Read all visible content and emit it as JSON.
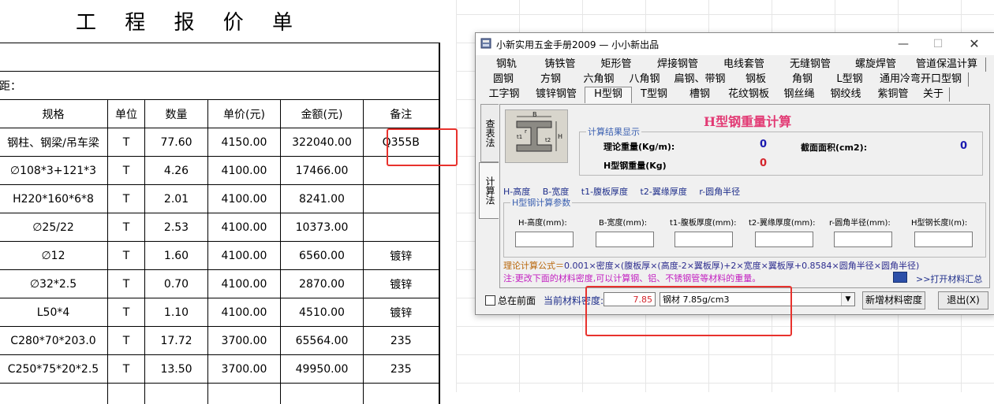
{
  "sheet": {
    "title": "工 程 报 价 单",
    "distance_label": "距：",
    "headers": [
      "规格",
      "单位",
      "数量",
      "单价(元)",
      "金额(元)",
      "备注"
    ],
    "rows": [
      {
        "spec": "钢柱、钢梁/吊车梁",
        "unit": "T",
        "qty": "77.60",
        "price": "4150.00",
        "amount": "322040.00",
        "note": "Q355B"
      },
      {
        "spec": "∅108*3+121*3",
        "unit": "T",
        "qty": "4.26",
        "price": "4100.00",
        "amount": "17466.00",
        "note": ""
      },
      {
        "spec": "H220*160*6*8",
        "unit": "T",
        "qty": "2.01",
        "price": "4100.00",
        "amount": "8241.00",
        "note": ""
      },
      {
        "spec": "∅25/22",
        "unit": "T",
        "qty": "2.53",
        "price": "4100.00",
        "amount": "10373.00",
        "note": ""
      },
      {
        "spec": "∅12",
        "unit": "T",
        "qty": "1.60",
        "price": "4100.00",
        "amount": "6560.00",
        "note": "镀锌"
      },
      {
        "spec": "∅32*2.5",
        "unit": "T",
        "qty": "0.70",
        "price": "4100.00",
        "amount": "2870.00",
        "note": "镀锌"
      },
      {
        "spec": "L50*4",
        "unit": "T",
        "qty": "1.10",
        "price": "4100.00",
        "amount": "4510.00",
        "note": "镀锌"
      },
      {
        "spec": "C280*70*203.0",
        "unit": "T",
        "qty": "17.72",
        "price": "3700.00",
        "amount": "65564.00",
        "note": "235"
      },
      {
        "spec": "C250*75*20*2.5",
        "unit": "T",
        "qty": "13.50",
        "price": "3700.00",
        "amount": "49950.00",
        "note": "235"
      }
    ]
  },
  "window": {
    "title": "小新实用五金手册2009 — 小小新出品",
    "minimize": "—",
    "maximize": "☐",
    "close": "✕",
    "tabs_row1": [
      "钢轨",
      "铸铁管",
      "矩形管",
      "焊接钢管",
      "电线套管",
      "无缝钢管",
      "螺旋焊管",
      "管道保温计算"
    ],
    "tabs_row2": [
      "圆钢",
      "方钢",
      "六角钢",
      "八角钢",
      "扁钢、带钢",
      "钢板",
      "角钢",
      "L型钢",
      "通用冷弯开口型钢"
    ],
    "tabs_row3": [
      "工字钢",
      "镀锌钢管",
      "H型钢",
      "T型钢",
      "槽钢",
      "花纹钢板",
      "钢丝绳",
      "钢绞线",
      "紫铜管",
      "关于"
    ],
    "active_tab": "H型钢",
    "vtab_check": "查表法",
    "vtab_calc": "计算法",
    "beam_labels": {
      "b": "B",
      "h": "H",
      "t1": "t1",
      "t2": "t2",
      "r": "r"
    },
    "calc_title": "H型钢重量计算",
    "result_group_title": "计算结果显示",
    "theoretical_weight_label": "理论重量(Kg/m):",
    "theoretical_weight_value": "0",
    "section_area_label": "截面面积(cm2):",
    "section_area_value": "0",
    "h_weight_label": "H型钢重量(Kg)",
    "h_weight_value": "0",
    "legend": [
      "H-高度",
      "B-宽度",
      "t1-腹板厚度",
      "t2-翼缘厚度",
      "r-圆角半径"
    ],
    "param_group_title": "H型钢计算参数",
    "params": [
      "H-高度(mm):",
      "B-宽度(mm):",
      "t1-腹板厚度(mm):",
      "t2-翼缘厚度(mm):",
      "r-圆角半径(mm):",
      "H型钢长度l(m):"
    ],
    "formula_label": "理论计算公式＝",
    "formula_body": "0.001×密度×(腹板厚×(高度-2×翼板厚)+2×宽度×翼板厚+0.8584×圆角半径×圆角半径)",
    "note": "注:更改下面的材料密度,可以计算钢、铝、不锈钢管等材料的重量。",
    "summary_link": ">>打开材料汇总",
    "always_on_top_label": "总在前面",
    "density_label": "当前材料密度:",
    "density_value": "7.85",
    "material_selected": "钢材 7.85g/cm3",
    "add_density_button": "新增材料密度",
    "exit_button": "退出(X)"
  },
  "colors": {
    "highlight_box": "#e8322d",
    "calc_title": "#e23a74",
    "label_blue": "#1d2d8a",
    "note_magenta": "#c21ec0",
    "result_red": "#d4252c",
    "result_blue": "#1a1ab0"
  }
}
